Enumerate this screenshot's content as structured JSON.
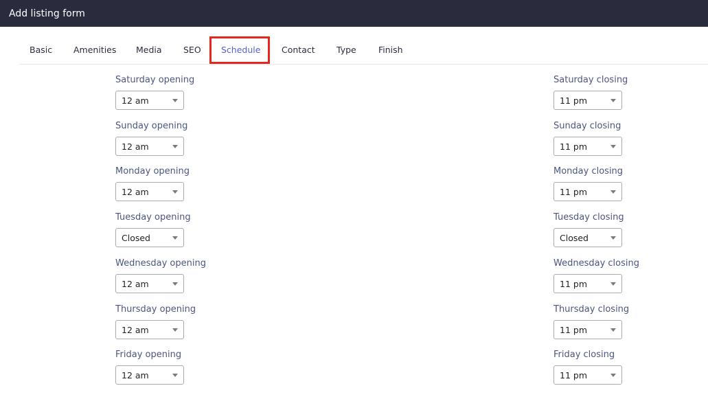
{
  "header": {
    "title": "Add listing form"
  },
  "tabs": [
    {
      "label": "Basic"
    },
    {
      "label": "Amenities"
    },
    {
      "label": "Media"
    },
    {
      "label": "SEO"
    },
    {
      "label": "Schedule"
    },
    {
      "label": "Contact"
    },
    {
      "label": "Type"
    },
    {
      "label": "Finish"
    }
  ],
  "active_tab": "Schedule",
  "highlight_color": "#e5281b",
  "accent_color": "#5560c9",
  "schedule": {
    "opening": [
      {
        "label": "Saturday opening",
        "value": "12 am"
      },
      {
        "label": "Sunday opening",
        "value": "12 am"
      },
      {
        "label": "Monday opening",
        "value": "12 am"
      },
      {
        "label": "Tuesday opening",
        "value": "Closed"
      },
      {
        "label": "Wednesday opening",
        "value": "12 am"
      },
      {
        "label": "Thursday opening",
        "value": "12 am"
      },
      {
        "label": "Friday opening",
        "value": "12 am"
      }
    ],
    "closing": [
      {
        "label": "Saturday closing",
        "value": "11 pm"
      },
      {
        "label": "Sunday closing",
        "value": "11 pm"
      },
      {
        "label": "Monday closing",
        "value": "11 pm"
      },
      {
        "label": "Tuesday closing",
        "value": "Closed"
      },
      {
        "label": "Wednesday closing",
        "value": "11 pm"
      },
      {
        "label": "Thursday closing",
        "value": "11 pm"
      },
      {
        "label": "Friday closing",
        "value": "11 pm"
      }
    ]
  },
  "icons": {
    "dropdown": "caret-down-icon"
  }
}
